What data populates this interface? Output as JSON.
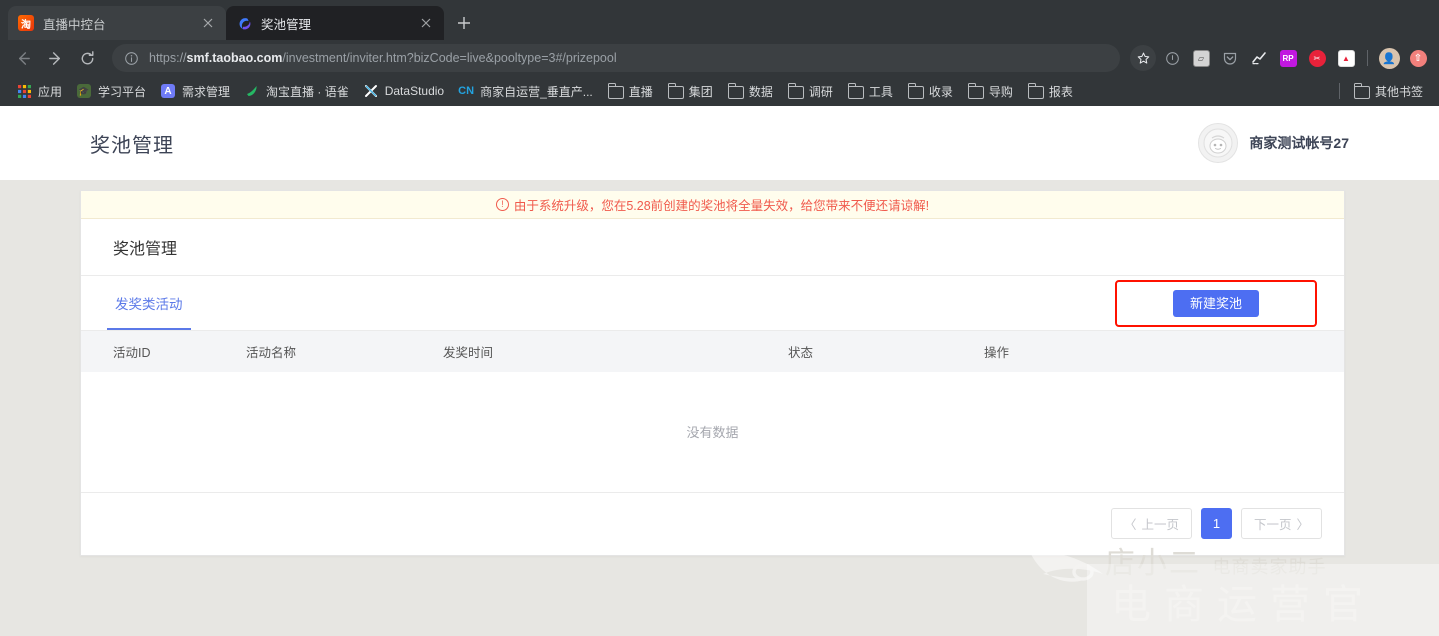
{
  "browser": {
    "tabs": [
      {
        "title": "直播中控台",
        "favicon": "taobao-icon",
        "active": false
      },
      {
        "title": "奖池管理",
        "favicon": "aliyun-icon",
        "active": true
      }
    ],
    "new_tab_label": "+",
    "nav": {
      "back": "←",
      "forward": "→",
      "reload": "⟳"
    },
    "omnibox": {
      "scheme": "https://",
      "domain": "smf.taobao.com",
      "path": "/investment/inviter.htm?bizCode=live&pooltype=3#/prizepool",
      "full_url": "https://smf.taobao.com/investment/inviter.htm?bizCode=live&pooltype=3#/prizepool"
    },
    "toolbar_icons": [
      "star-icon",
      "info-circle-icon",
      "screenshot-extension-icon",
      "pocket-extension-icon",
      "analytics-extension-icon",
      "rp-extension-icon",
      "tool-extension-icon",
      "note-extension-icon",
      "profile-avatar-icon",
      "update-icon"
    ],
    "bookmarks": [
      {
        "label": "应用",
        "icon": "apps-grid-icon"
      },
      {
        "label": "学习平台",
        "icon": "study-icon"
      },
      {
        "label": "需求管理",
        "icon": "letter-a-icon"
      },
      {
        "label": "淘宝直播 · 语雀",
        "icon": "yuque-icon"
      },
      {
        "label": "DataStudio",
        "icon": "datastudio-icon"
      },
      {
        "label": "商家自运营_垂直产...",
        "icon": "cn-icon"
      },
      {
        "label": "直播",
        "icon": "folder-icon"
      },
      {
        "label": "集团",
        "icon": "folder-icon"
      },
      {
        "label": "数据",
        "icon": "folder-icon"
      },
      {
        "label": "调研",
        "icon": "folder-icon"
      },
      {
        "label": "工具",
        "icon": "folder-icon"
      },
      {
        "label": "收录",
        "icon": "folder-icon"
      },
      {
        "label": "导购",
        "icon": "folder-icon"
      },
      {
        "label": "报表",
        "icon": "folder-icon"
      }
    ],
    "other_bookmarks": {
      "label": "其他书签",
      "icon": "folder-icon"
    }
  },
  "site": {
    "title": "奖池管理",
    "user": {
      "name": "商家测试帐号27",
      "avatar": "user-avatar-icon"
    }
  },
  "alert": {
    "icon": "exclamation-circle-icon",
    "text": "由于系统升级，您在5.28前创建的奖池将全量失效，给您带来不便还请谅解!",
    "color": "#f05a4c",
    "background": "#fffded"
  },
  "card": {
    "title": "奖池管理",
    "tabs": [
      {
        "label": "发奖类活动",
        "active": true
      }
    ],
    "primary_button": {
      "label": "新建奖池",
      "color": "#4d6ef2"
    },
    "highlight_color": "#ff1100"
  },
  "table": {
    "columns": [
      "活动ID",
      "活动名称",
      "发奖时间",
      "状态",
      "操作"
    ],
    "rows": [],
    "empty_text": "没有数据"
  },
  "pagination": {
    "prev_label": "上一页",
    "next_label": "下一页",
    "prev_arrow": "〈",
    "next_arrow": "〉",
    "current_page": "1"
  },
  "watermark": {
    "brand": "店小二",
    "tagline": "电商卖家助手",
    "big_text": "电商运营官"
  }
}
